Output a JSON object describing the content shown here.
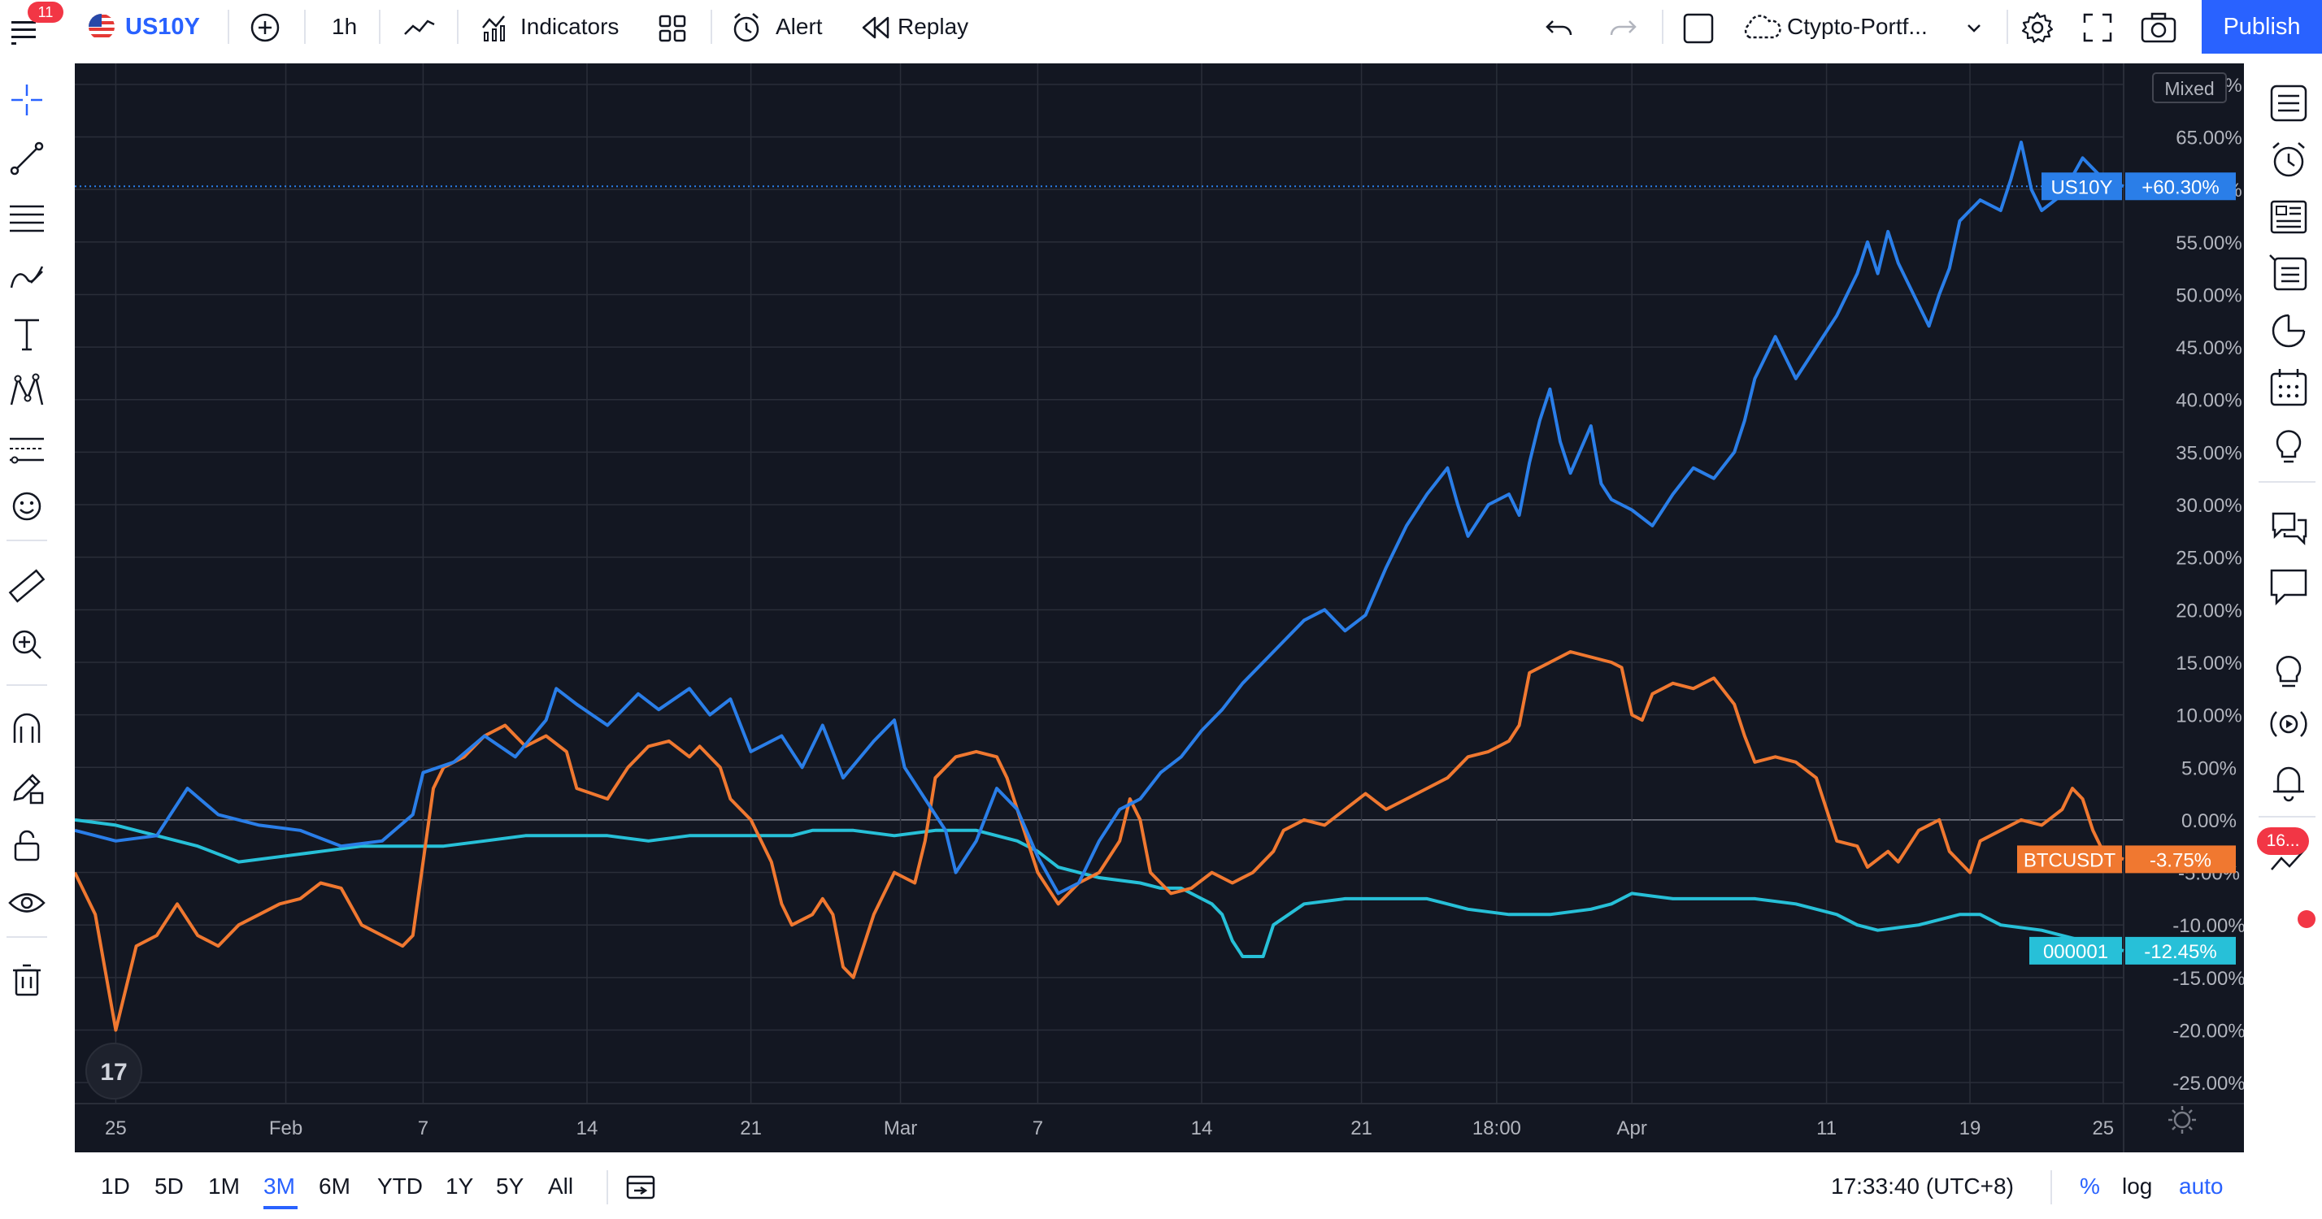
{
  "topbar": {
    "menu_badge": "11",
    "symbol": "US10Y",
    "interval": "1h",
    "indicators_label": "Indicators",
    "alert_label": "Alert",
    "replay_label": "Replay",
    "layout_name": "Ctypto-Portf...",
    "publish_label": "Publish"
  },
  "right_toolbar": {
    "badge": "16..."
  },
  "chart_data": {
    "type": "line",
    "scale_mode": "percent",
    "mixed_label": "Mixed",
    "y_ticks": [
      "70.00%",
      "65.00%",
      "60.00%",
      "55.00%",
      "50.00%",
      "45.00%",
      "40.00%",
      "35.00%",
      "30.00%",
      "25.00%",
      "20.00%",
      "15.00%",
      "10.00%",
      "5.00%",
      "0.00%",
      "-5.00%",
      "-10.00%",
      "-15.00%",
      "-20.00%",
      "-25.00%"
    ],
    "ylim": [
      -27,
      72
    ],
    "x_ticks": [
      {
        "label": "25",
        "pos": 0.02
      },
      {
        "label": "Feb",
        "pos": 0.103
      },
      {
        "label": "7",
        "pos": 0.17
      },
      {
        "label": "14",
        "pos": 0.25
      },
      {
        "label": "21",
        "pos": 0.33
      },
      {
        "label": "Mar",
        "pos": 0.403
      },
      {
        "label": "7",
        "pos": 0.47
      },
      {
        "label": "14",
        "pos": 0.55
      },
      {
        "label": "21",
        "pos": 0.628
      },
      {
        "label": "18:00",
        "pos": 0.694
      },
      {
        "label": "Apr",
        "pos": 0.76
      },
      {
        "label": "11",
        "pos": 0.855
      },
      {
        "label": "19",
        "pos": 0.925
      },
      {
        "label": "25",
        "pos": 0.99
      }
    ],
    "series": [
      {
        "name": "US10Y",
        "color": "#2a7ee8",
        "last_value": "+60.30%",
        "last": 60.3,
        "points": [
          [
            0,
            -1
          ],
          [
            0.02,
            -2
          ],
          [
            0.04,
            -1.5
          ],
          [
            0.055,
            3
          ],
          [
            0.07,
            0.5
          ],
          [
            0.09,
            -0.5
          ],
          [
            0.11,
            -1
          ],
          [
            0.13,
            -2.5
          ],
          [
            0.15,
            -2
          ],
          [
            0.165,
            0.5
          ],
          [
            0.17,
            4.5
          ],
          [
            0.185,
            5.5
          ],
          [
            0.2,
            8
          ],
          [
            0.215,
            6
          ],
          [
            0.23,
            9.5
          ],
          [
            0.235,
            12.5
          ],
          [
            0.245,
            11
          ],
          [
            0.26,
            9
          ],
          [
            0.275,
            12
          ],
          [
            0.285,
            10.5
          ],
          [
            0.3,
            12.5
          ],
          [
            0.31,
            10
          ],
          [
            0.32,
            11.5
          ],
          [
            0.33,
            6.5
          ],
          [
            0.345,
            8
          ],
          [
            0.355,
            5
          ],
          [
            0.365,
            9
          ],
          [
            0.375,
            4
          ],
          [
            0.39,
            7.5
          ],
          [
            0.4,
            9.5
          ],
          [
            0.405,
            5
          ],
          [
            0.415,
            2
          ],
          [
            0.425,
            -1
          ],
          [
            0.43,
            -5
          ],
          [
            0.44,
            -2
          ],
          [
            0.45,
            3
          ],
          [
            0.46,
            1
          ],
          [
            0.47,
            -3.5
          ],
          [
            0.48,
            -7
          ],
          [
            0.49,
            -6
          ],
          [
            0.5,
            -2
          ],
          [
            0.51,
            1
          ],
          [
            0.52,
            2
          ],
          [
            0.53,
            4.5
          ],
          [
            0.54,
            6
          ],
          [
            0.55,
            8.5
          ],
          [
            0.56,
            10.5
          ],
          [
            0.57,
            13
          ],
          [
            0.58,
            15
          ],
          [
            0.59,
            17
          ],
          [
            0.6,
            19
          ],
          [
            0.61,
            20
          ],
          [
            0.62,
            18
          ],
          [
            0.63,
            19.5
          ],
          [
            0.64,
            24
          ],
          [
            0.65,
            28
          ],
          [
            0.66,
            31
          ],
          [
            0.67,
            33.5
          ],
          [
            0.675,
            30
          ],
          [
            0.68,
            27
          ],
          [
            0.69,
            30
          ],
          [
            0.7,
            31
          ],
          [
            0.705,
            29
          ],
          [
            0.71,
            34
          ],
          [
            0.715,
            38
          ],
          [
            0.72,
            41
          ],
          [
            0.725,
            36
          ],
          [
            0.73,
            33
          ],
          [
            0.74,
            37.5
          ],
          [
            0.745,
            32
          ],
          [
            0.75,
            30.5
          ],
          [
            0.76,
            29.5
          ],
          [
            0.77,
            28
          ],
          [
            0.78,
            31
          ],
          [
            0.79,
            33.5
          ],
          [
            0.8,
            32.5
          ],
          [
            0.81,
            35
          ],
          [
            0.815,
            38
          ],
          [
            0.82,
            42
          ],
          [
            0.83,
            46
          ],
          [
            0.84,
            42
          ],
          [
            0.85,
            45
          ],
          [
            0.86,
            48
          ],
          [
            0.87,
            52
          ],
          [
            0.875,
            55
          ],
          [
            0.88,
            52
          ],
          [
            0.885,
            56
          ],
          [
            0.89,
            53
          ],
          [
            0.9,
            49
          ],
          [
            0.905,
            47
          ],
          [
            0.91,
            50
          ],
          [
            0.915,
            52.5
          ],
          [
            0.92,
            57
          ],
          [
            0.93,
            59
          ],
          [
            0.94,
            58
          ],
          [
            0.945,
            61
          ],
          [
            0.95,
            64.5
          ],
          [
            0.955,
            60
          ],
          [
            0.96,
            58
          ],
          [
            0.97,
            59.5
          ],
          [
            0.98,
            63
          ],
          [
            0.99,
            61
          ],
          [
            1,
            60.3
          ]
        ]
      },
      {
        "name": "BTCUSDT",
        "color": "#f07830",
        "last_value": "-3.75%",
        "last": -3.75,
        "points": [
          [
            0,
            -5
          ],
          [
            0.01,
            -9
          ],
          [
            0.02,
            -20
          ],
          [
            0.03,
            -12
          ],
          [
            0.04,
            -11
          ],
          [
            0.05,
            -8
          ],
          [
            0.06,
            -11
          ],
          [
            0.07,
            -12
          ],
          [
            0.08,
            -10
          ],
          [
            0.09,
            -9
          ],
          [
            0.1,
            -8
          ],
          [
            0.11,
            -7.5
          ],
          [
            0.12,
            -6
          ],
          [
            0.13,
            -6.5
          ],
          [
            0.14,
            -10
          ],
          [
            0.15,
            -11
          ],
          [
            0.16,
            -12
          ],
          [
            0.165,
            -11
          ],
          [
            0.17,
            -4
          ],
          [
            0.175,
            3
          ],
          [
            0.18,
            5
          ],
          [
            0.19,
            6
          ],
          [
            0.2,
            8
          ],
          [
            0.21,
            9
          ],
          [
            0.22,
            7
          ],
          [
            0.23,
            8
          ],
          [
            0.24,
            6.5
          ],
          [
            0.245,
            3
          ],
          [
            0.26,
            2
          ],
          [
            0.27,
            5
          ],
          [
            0.28,
            7
          ],
          [
            0.29,
            7.5
          ],
          [
            0.3,
            6
          ],
          [
            0.305,
            7
          ],
          [
            0.315,
            5
          ],
          [
            0.32,
            2
          ],
          [
            0.33,
            0
          ],
          [
            0.335,
            -2
          ],
          [
            0.34,
            -4
          ],
          [
            0.345,
            -8
          ],
          [
            0.35,
            -10
          ],
          [
            0.36,
            -9
          ],
          [
            0.365,
            -7.5
          ],
          [
            0.37,
            -9
          ],
          [
            0.375,
            -14
          ],
          [
            0.38,
            -15
          ],
          [
            0.39,
            -9
          ],
          [
            0.4,
            -5
          ],
          [
            0.41,
            -6
          ],
          [
            0.415,
            -2
          ],
          [
            0.42,
            4
          ],
          [
            0.43,
            6
          ],
          [
            0.44,
            6.5
          ],
          [
            0.45,
            6
          ],
          [
            0.455,
            4
          ],
          [
            0.46,
            1
          ],
          [
            0.465,
            -2
          ],
          [
            0.47,
            -5
          ],
          [
            0.48,
            -8
          ],
          [
            0.49,
            -6
          ],
          [
            0.5,
            -5
          ],
          [
            0.51,
            -2
          ],
          [
            0.515,
            2
          ],
          [
            0.52,
            0
          ],
          [
            0.525,
            -5
          ],
          [
            0.535,
            -7
          ],
          [
            0.545,
            -6.5
          ],
          [
            0.555,
            -5
          ],
          [
            0.565,
            -6
          ],
          [
            0.575,
            -5
          ],
          [
            0.585,
            -3
          ],
          [
            0.59,
            -1
          ],
          [
            0.6,
            0
          ],
          [
            0.61,
            -0.5
          ],
          [
            0.62,
            1
          ],
          [
            0.63,
            2.5
          ],
          [
            0.64,
            1
          ],
          [
            0.65,
            2
          ],
          [
            0.66,
            3
          ],
          [
            0.67,
            4
          ],
          [
            0.68,
            6
          ],
          [
            0.69,
            6.5
          ],
          [
            0.7,
            7.5
          ],
          [
            0.705,
            9
          ],
          [
            0.71,
            14
          ],
          [
            0.72,
            15
          ],
          [
            0.73,
            16
          ],
          [
            0.74,
            15.5
          ],
          [
            0.75,
            15
          ],
          [
            0.755,
            14.5
          ],
          [
            0.76,
            10
          ],
          [
            0.765,
            9.5
          ],
          [
            0.77,
            12
          ],
          [
            0.78,
            13
          ],
          [
            0.79,
            12.5
          ],
          [
            0.8,
            13.5
          ],
          [
            0.81,
            11
          ],
          [
            0.815,
            8
          ],
          [
            0.82,
            5.5
          ],
          [
            0.83,
            6
          ],
          [
            0.84,
            5.5
          ],
          [
            0.85,
            4
          ],
          [
            0.86,
            -2
          ],
          [
            0.87,
            -2.5
          ],
          [
            0.875,
            -4.5
          ],
          [
            0.885,
            -3
          ],
          [
            0.89,
            -4
          ],
          [
            0.9,
            -1
          ],
          [
            0.91,
            0
          ],
          [
            0.915,
            -3
          ],
          [
            0.92,
            -4
          ],
          [
            0.925,
            -5
          ],
          [
            0.93,
            -2
          ],
          [
            0.94,
            -1
          ],
          [
            0.95,
            0
          ],
          [
            0.96,
            -0.5
          ],
          [
            0.97,
            1
          ],
          [
            0.975,
            3
          ],
          [
            0.98,
            2
          ],
          [
            0.985,
            -1
          ],
          [
            0.99,
            -3
          ],
          [
            1,
            -3.75
          ]
        ]
      },
      {
        "name": "000001",
        "color": "#27c0d8",
        "last_value": "-12.45%",
        "last": -12.45,
        "points": [
          [
            0,
            0
          ],
          [
            0.02,
            -0.5
          ],
          [
            0.04,
            -1.5
          ],
          [
            0.06,
            -2.5
          ],
          [
            0.08,
            -4
          ],
          [
            0.1,
            -3.5
          ],
          [
            0.12,
            -3
          ],
          [
            0.14,
            -2.5
          ],
          [
            0.16,
            -2.5
          ],
          [
            0.18,
            -2.5
          ],
          [
            0.2,
            -2
          ],
          [
            0.22,
            -1.5
          ],
          [
            0.24,
            -1.5
          ],
          [
            0.26,
            -1.5
          ],
          [
            0.28,
            -2
          ],
          [
            0.3,
            -1.5
          ],
          [
            0.32,
            -1.5
          ],
          [
            0.34,
            -1.5
          ],
          [
            0.35,
            -1.5
          ],
          [
            0.36,
            -1
          ],
          [
            0.38,
            -1
          ],
          [
            0.4,
            -1.5
          ],
          [
            0.42,
            -1
          ],
          [
            0.44,
            -1
          ],
          [
            0.46,
            -2
          ],
          [
            0.47,
            -3
          ],
          [
            0.48,
            -4.5
          ],
          [
            0.49,
            -5
          ],
          [
            0.5,
            -5.5
          ],
          [
            0.52,
            -6
          ],
          [
            0.53,
            -6.5
          ],
          [
            0.54,
            -6.5
          ],
          [
            0.55,
            -7.5
          ],
          [
            0.555,
            -8
          ],
          [
            0.56,
            -9
          ],
          [
            0.565,
            -11.5
          ],
          [
            0.57,
            -13
          ],
          [
            0.58,
            -13
          ],
          [
            0.585,
            -10
          ],
          [
            0.6,
            -8
          ],
          [
            0.62,
            -7.5
          ],
          [
            0.64,
            -7.5
          ],
          [
            0.66,
            -7.5
          ],
          [
            0.68,
            -8.5
          ],
          [
            0.7,
            -9
          ],
          [
            0.72,
            -9
          ],
          [
            0.74,
            -8.5
          ],
          [
            0.75,
            -8
          ],
          [
            0.76,
            -7
          ],
          [
            0.78,
            -7.5
          ],
          [
            0.8,
            -7.5
          ],
          [
            0.82,
            -7.5
          ],
          [
            0.84,
            -8
          ],
          [
            0.86,
            -9
          ],
          [
            0.87,
            -10
          ],
          [
            0.88,
            -10.5
          ],
          [
            0.9,
            -10
          ],
          [
            0.92,
            -9
          ],
          [
            0.93,
            -9
          ],
          [
            0.94,
            -10
          ],
          [
            0.96,
            -10.5
          ],
          [
            0.98,
            -11.5
          ],
          [
            1,
            -12.45
          ]
        ]
      }
    ],
    "time": "17:33:40 (UTC+8)"
  },
  "bottombar": {
    "ranges": [
      "1D",
      "5D",
      "1M",
      "3M",
      "6M",
      "YTD",
      "1Y",
      "5Y",
      "All"
    ],
    "active_range": "3M",
    "time": "17:33:40 (UTC+8)",
    "percent_label": "%",
    "log_label": "log",
    "auto_label": "auto"
  }
}
